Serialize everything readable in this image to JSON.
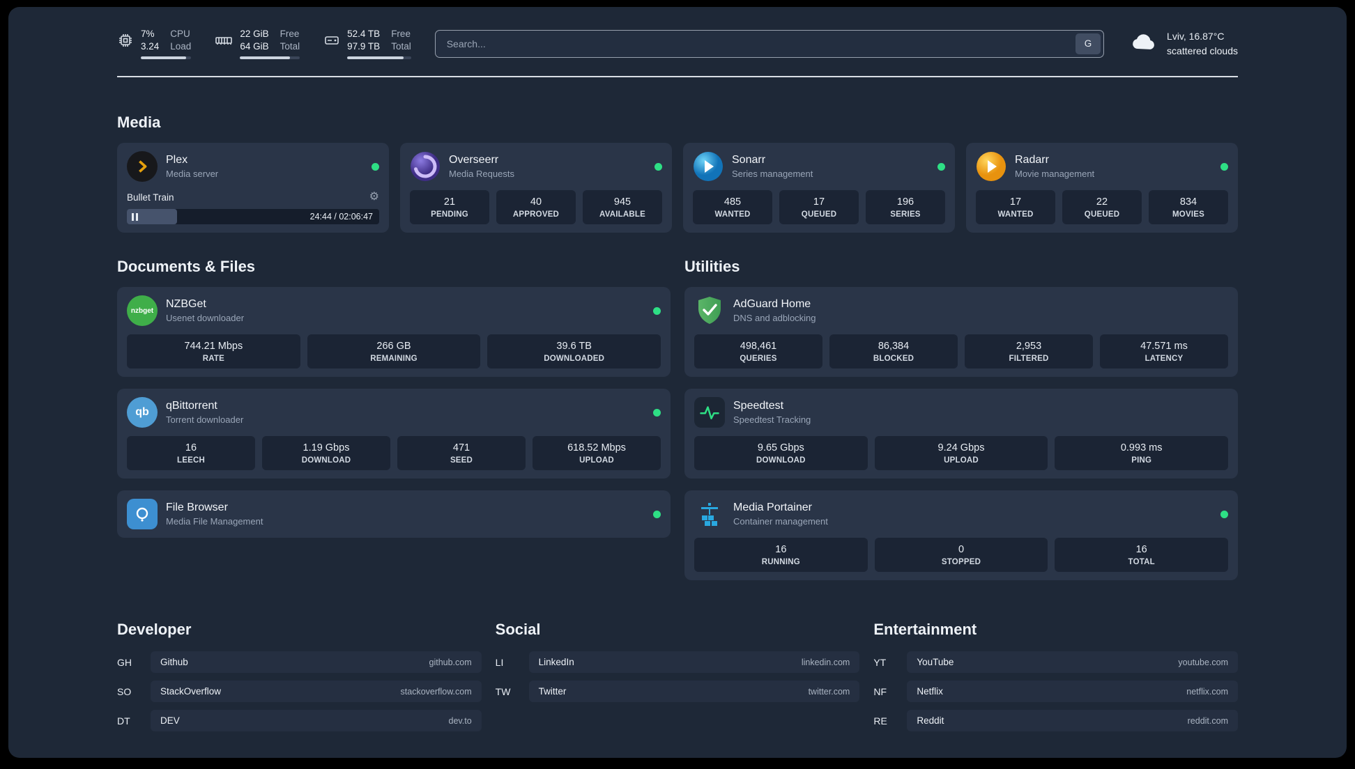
{
  "topbar": {
    "cpu": {
      "value": "7%",
      "sub": "3.24",
      "label_top": "CPU",
      "label_bottom": "Load",
      "progress_pct": 90
    },
    "memory": {
      "value": "22 GiB",
      "sub": "64 GiB",
      "label_top": "Free",
      "label_bottom": "Total",
      "progress_pct": 84
    },
    "disk": {
      "value": "52.4 TB",
      "sub": "97.9 TB",
      "label_top": "Free",
      "label_bottom": "Total",
      "progress_pct": 88
    },
    "search": {
      "placeholder": "Search...",
      "button_label": "G"
    },
    "weather": {
      "location": "Lviv, 16.87°C",
      "condition": "scattered clouds"
    }
  },
  "media": {
    "title": "Media",
    "plex": {
      "name": "Plex",
      "desc": "Media server",
      "now_playing": "Bullet Train",
      "time": "24:44 / 02:06:47",
      "progress_pct": 20
    },
    "overseerr": {
      "name": "Overseerr",
      "desc": "Media Requests",
      "stats": [
        {
          "value": "21",
          "label": "PENDING"
        },
        {
          "value": "40",
          "label": "APPROVED"
        },
        {
          "value": "945",
          "label": "AVAILABLE"
        }
      ]
    },
    "sonarr": {
      "name": "Sonarr",
      "desc": "Series management",
      "stats": [
        {
          "value": "485",
          "label": "WANTED"
        },
        {
          "value": "17",
          "label": "QUEUED"
        },
        {
          "value": "196",
          "label": "SERIES"
        }
      ]
    },
    "radarr": {
      "name": "Radarr",
      "desc": "Movie management",
      "stats": [
        {
          "value": "17",
          "label": "WANTED"
        },
        {
          "value": "22",
          "label": "QUEUED"
        },
        {
          "value": "834",
          "label": "MOVIES"
        }
      ]
    }
  },
  "documents": {
    "title": "Documents & Files",
    "nzbget": {
      "name": "NZBGet",
      "desc": "Usenet downloader",
      "icon_label": "nzbget",
      "stats": [
        {
          "value": "744.21 Mbps",
          "label": "RATE"
        },
        {
          "value": "266 GB",
          "label": "REMAINING"
        },
        {
          "value": "39.6 TB",
          "label": "DOWNLOADED"
        }
      ]
    },
    "qbittorrent": {
      "name": "qBittorrent",
      "desc": "Torrent downloader",
      "icon_label": "qb",
      "stats": [
        {
          "value": "16",
          "label": "LEECH"
        },
        {
          "value": "1.19 Gbps",
          "label": "DOWNLOAD"
        },
        {
          "value": "471",
          "label": "SEED"
        },
        {
          "value": "618.52 Mbps",
          "label": "UPLOAD"
        }
      ]
    },
    "filebrowser": {
      "name": "File Browser",
      "desc": "Media File Management"
    }
  },
  "utilities": {
    "title": "Utilities",
    "adguard": {
      "name": "AdGuard Home",
      "desc": "DNS and adblocking",
      "stats": [
        {
          "value": "498,461",
          "label": "QUERIES"
        },
        {
          "value": "86,384",
          "label": "BLOCKED"
        },
        {
          "value": "2,953",
          "label": "FILTERED"
        },
        {
          "value": "47.571 ms",
          "label": "LATENCY"
        }
      ]
    },
    "speedtest": {
      "name": "Speedtest",
      "desc": "Speedtest Tracking",
      "stats": [
        {
          "value": "9.65 Gbps",
          "label": "DOWNLOAD"
        },
        {
          "value": "9.24 Gbps",
          "label": "UPLOAD"
        },
        {
          "value": "0.993 ms",
          "label": "PING"
        }
      ]
    },
    "portainer": {
      "name": "Media Portainer",
      "desc": "Container management",
      "stats": [
        {
          "value": "16",
          "label": "RUNNING"
        },
        {
          "value": "0",
          "label": "STOPPED"
        },
        {
          "value": "16",
          "label": "TOTAL"
        }
      ]
    }
  },
  "bookmarks": {
    "developer": {
      "title": "Developer",
      "items": [
        {
          "abbr": "GH",
          "name": "Github",
          "url": "github.com"
        },
        {
          "abbr": "SO",
          "name": "StackOverflow",
          "url": "stackoverflow.com"
        },
        {
          "abbr": "DT",
          "name": "DEV",
          "url": "dev.to"
        }
      ]
    },
    "social": {
      "title": "Social",
      "items": [
        {
          "abbr": "LI",
          "name": "LinkedIn",
          "url": "linkedin.com"
        },
        {
          "abbr": "TW",
          "name": "Twitter",
          "url": "twitter.com"
        }
      ]
    },
    "entertainment": {
      "title": "Entertainment",
      "items": [
        {
          "abbr": "YT",
          "name": "YouTube",
          "url": "youtube.com"
        },
        {
          "abbr": "NF",
          "name": "Netflix",
          "url": "netflix.com"
        },
        {
          "abbr": "RE",
          "name": "Reddit",
          "url": "reddit.com"
        }
      ]
    }
  },
  "colors": {
    "status_online": "#2edf85",
    "plex_accent": "#e5a00d"
  }
}
